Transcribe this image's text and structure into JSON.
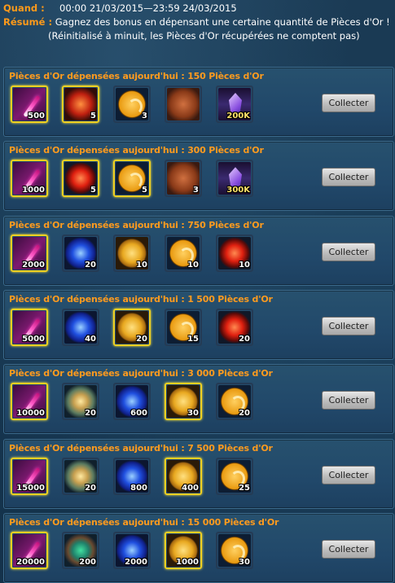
{
  "header": {
    "when_label": "Quand :",
    "when_value": "00:00 21/03/2015—23:59 24/03/2015",
    "summary_label": "Résumé :",
    "summary_value": "Gagnez des bonus en dépensant une certaine quantité de Pièces d'Or !",
    "summary_note": "(Réinitialisé à minuit, les Pièces d'Or récupérées ne comptent pas)"
  },
  "button_label": "Collecter",
  "tiers": [
    {
      "title": "Pièces d'Or dépensées aujourd'hui :  150 Pièces d'Or",
      "items": [
        {
          "icon": "feather-icon",
          "qty": "500",
          "frame": "gold"
        },
        {
          "icon": "spiral-orb-icon",
          "qty": "5",
          "frame": "gold"
        },
        {
          "icon": "gold-coin-icon",
          "qty": "3",
          "frame": "dark"
        },
        {
          "icon": "pouch-icon",
          "qty": "",
          "frame": "dark"
        },
        {
          "icon": "purple-crystal-icon",
          "qty": "200K",
          "frame": "dark"
        }
      ]
    },
    {
      "title": "Pièces d'Or dépensées aujourd'hui :  300 Pièces d'Or",
      "items": [
        {
          "icon": "feather-icon",
          "qty": "1000",
          "frame": "gold"
        },
        {
          "icon": "red-orb-icon",
          "qty": "5",
          "frame": "gold"
        },
        {
          "icon": "gold-coin-icon",
          "qty": "5",
          "frame": "gold"
        },
        {
          "icon": "pouch-icon",
          "qty": "3",
          "frame": "dark"
        },
        {
          "icon": "purple-crystal-icon",
          "qty": "300K",
          "frame": "dark"
        }
      ]
    },
    {
      "title": "Pièces d'Or dépensées aujourd'hui :  750 Pièces d'Or",
      "items": [
        {
          "icon": "feather-icon",
          "qty": "2000",
          "frame": "gold"
        },
        {
          "icon": "blue-orb-icon",
          "qty": "20",
          "frame": "dark"
        },
        {
          "icon": "gold-medal-icon",
          "qty": "10",
          "frame": "dark"
        },
        {
          "icon": "gold-coin-icon",
          "qty": "10",
          "frame": "dark"
        },
        {
          "icon": "red-orb-icon",
          "qty": "10",
          "frame": "dark"
        }
      ]
    },
    {
      "title": "Pièces d'Or dépensées aujourd'hui :  1 500 Pièces d'Or",
      "items": [
        {
          "icon": "feather-icon",
          "qty": "5000",
          "frame": "gold"
        },
        {
          "icon": "blue-orb-icon",
          "qty": "40",
          "frame": "dark"
        },
        {
          "icon": "gold-medal-icon",
          "qty": "20",
          "frame": "gold"
        },
        {
          "icon": "gold-coin-icon",
          "qty": "15",
          "frame": "dark"
        },
        {
          "icon": "red-orb-icon",
          "qty": "20",
          "frame": "dark"
        }
      ]
    },
    {
      "title": "Pièces d'Or dépensées aujourd'hui :  3 000 Pièces d'Or",
      "items": [
        {
          "icon": "feather-icon",
          "qty": "10000",
          "frame": "gold"
        },
        {
          "icon": "emblem-icon",
          "qty": "20",
          "frame": "dark"
        },
        {
          "icon": "blue-orb-icon",
          "qty": "600",
          "frame": "dark"
        },
        {
          "icon": "gold-medal-icon",
          "qty": "30",
          "frame": "gold"
        },
        {
          "icon": "gold-coin-icon",
          "qty": "20",
          "frame": "dark"
        }
      ]
    },
    {
      "title": "Pièces d'Or dépensées aujourd'hui :  7 500 Pièces d'Or",
      "items": [
        {
          "icon": "feather-icon",
          "qty": "15000",
          "frame": "gold"
        },
        {
          "icon": "emblem-icon",
          "qty": "20",
          "frame": "dark"
        },
        {
          "icon": "blue-orb-icon",
          "qty": "800",
          "frame": "dark"
        },
        {
          "icon": "gold-medal-icon",
          "qty": "400",
          "frame": "gold"
        },
        {
          "icon": "gold-coin-icon",
          "qty": "25",
          "frame": "dark"
        }
      ]
    },
    {
      "title": "Pièces d'Or dépensées aujourd'hui :  15 000 Pièces d'Or",
      "items": [
        {
          "icon": "feather-icon",
          "qty": "20000",
          "frame": "gold"
        },
        {
          "icon": "green-emblem-icon",
          "qty": "200",
          "frame": "dark"
        },
        {
          "icon": "blue-orb-icon",
          "qty": "2000",
          "frame": "dark"
        },
        {
          "icon": "gold-medal-icon",
          "qty": "1000",
          "frame": "gold"
        },
        {
          "icon": "gold-coin-icon",
          "qty": "30",
          "frame": "dark"
        }
      ]
    }
  ]
}
